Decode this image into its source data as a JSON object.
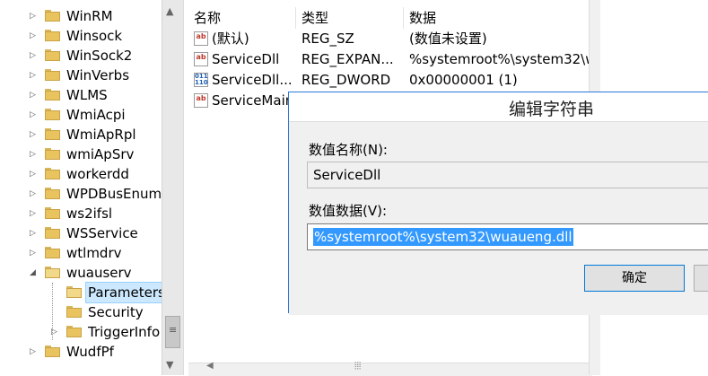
{
  "tree": {
    "items": [
      {
        "label": "WinRM",
        "expander": "▷",
        "open": false,
        "level": 0,
        "selected": false
      },
      {
        "label": "Winsock",
        "expander": "▷",
        "open": false,
        "level": 0,
        "selected": false
      },
      {
        "label": "WinSock2",
        "expander": "▷",
        "open": false,
        "level": 0,
        "selected": false
      },
      {
        "label": "WinVerbs",
        "expander": "▷",
        "open": false,
        "level": 0,
        "selected": false
      },
      {
        "label": "WLMS",
        "expander": "▷",
        "open": false,
        "level": 0,
        "selected": false
      },
      {
        "label": "WmiAcpi",
        "expander": "▷",
        "open": false,
        "level": 0,
        "selected": false
      },
      {
        "label": "WmiApRpl",
        "expander": "▷",
        "open": false,
        "level": 0,
        "selected": false
      },
      {
        "label": "wmiApSrv",
        "expander": "▷",
        "open": false,
        "level": 0,
        "selected": false
      },
      {
        "label": "workerdd",
        "expander": "▷",
        "open": false,
        "level": 0,
        "selected": false
      },
      {
        "label": "WPDBusEnum",
        "expander": "▷",
        "open": false,
        "level": 0,
        "selected": false
      },
      {
        "label": "ws2ifsl",
        "expander": "▷",
        "open": false,
        "level": 0,
        "selected": false
      },
      {
        "label": "WSService",
        "expander": "▷",
        "open": false,
        "level": 0,
        "selected": false
      },
      {
        "label": "wtlmdrv",
        "expander": "▷",
        "open": false,
        "level": 0,
        "selected": false
      },
      {
        "label": "wuauserv",
        "expander": "◢",
        "open": true,
        "level": 0,
        "selected": false
      },
      {
        "label": "Parameters",
        "expander": "",
        "open": true,
        "level": 1,
        "selected": true
      },
      {
        "label": "Security",
        "expander": "",
        "open": false,
        "level": 1,
        "selected": false
      },
      {
        "label": "TriggerInfo",
        "expander": "▷",
        "open": false,
        "level": 1,
        "selected": false
      },
      {
        "label": "WudfPf",
        "expander": "▷",
        "open": false,
        "level": 0,
        "selected": false
      }
    ]
  },
  "list": {
    "headers": {
      "name": "名称",
      "type": "类型",
      "data": "数据"
    },
    "rows": [
      {
        "icon": "string-value-icon",
        "name": "(默认)",
        "type": "REG_SZ",
        "data": "(数值未设置)"
      },
      {
        "icon": "string-value-icon",
        "name": "ServiceDll",
        "type": "REG_EXPAN...",
        "data": "%systemroot%\\system32\\w"
      },
      {
        "icon": "binary-value-icon",
        "name": "ServiceDll...",
        "type": "REG_DWORD",
        "data": "0x00000001 (1)"
      },
      {
        "icon": "string-value-icon",
        "name": "ServiceMain",
        "type": "",
        "data": ""
      }
    ]
  },
  "dialog": {
    "title": "编辑字符串",
    "value_name_label": "数值名称(N):",
    "value_name": "ServiceDll",
    "value_data_label": "数值数据(V):",
    "value_data": "%systemroot%\\system32\\wuaueng.dll",
    "ok_label": "确定",
    "cancel_label": ""
  }
}
